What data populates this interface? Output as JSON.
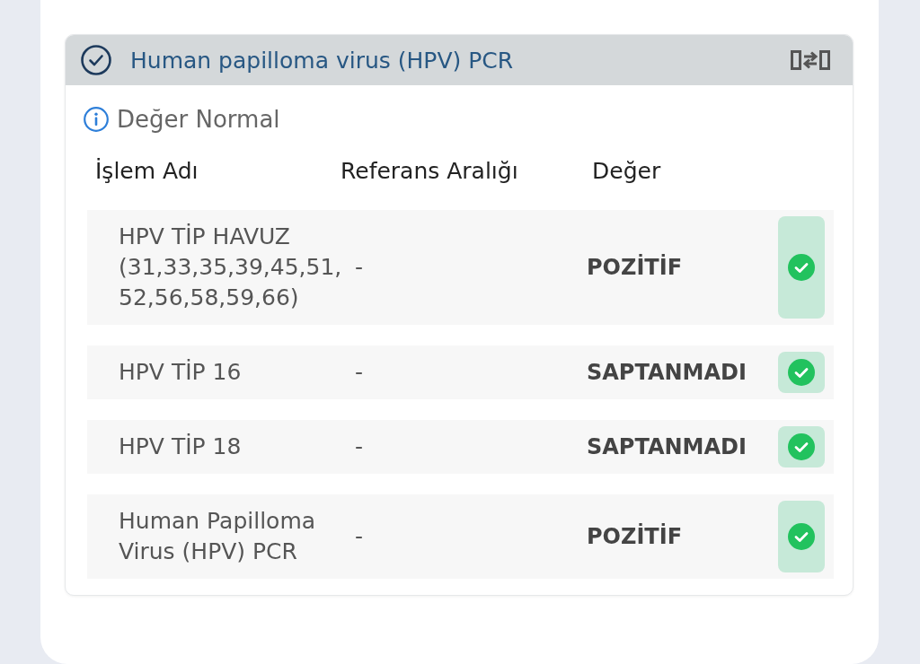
{
  "result_card": {
    "title": "Human papilloma virus (HPV) PCR",
    "status_note": "Değer Normal",
    "table": {
      "columns": [
        "İşlem Adı",
        "Referans Aralığı",
        "Değer"
      ],
      "rows": [
        {
          "name": "HPV TİP HAVUZ (31,33,35,39,45,51, 52,56,58,59,66)",
          "reference_range": "-",
          "value": "POZİTİF"
        },
        {
          "name": "HPV TİP 16",
          "reference_range": "-",
          "value": "SAPTANMADI"
        },
        {
          "name": "HPV TİP 18",
          "reference_range": "-",
          "value": "SAPTANMADI"
        },
        {
          "name": "Human Papilloma Virus (HPV) PCR",
          "reference_range": "-",
          "value": "POZİTİF"
        }
      ]
    }
  }
}
